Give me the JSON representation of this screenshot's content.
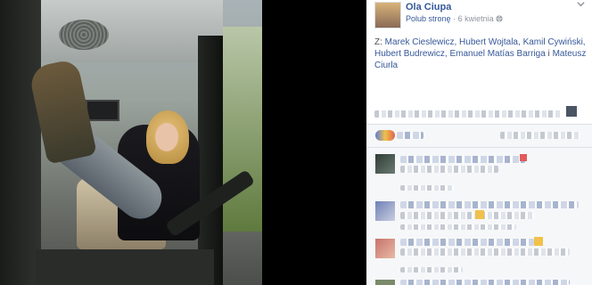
{
  "post": {
    "author": "Ola Ciupa",
    "like_page": "Polub stronę",
    "separator": "·",
    "date": "6 kwietnia",
    "privacy_icon": "globe-icon",
    "menu_icon": "chevron-down-icon"
  },
  "tags": {
    "label": "Z:",
    "people": [
      "Marek Cieslewicz,",
      "Hubert Wojtala,",
      "Kamil Cywiński,",
      "Hubert Budrewicz,",
      "Emanuel Matías Barriga",
      "i",
      "Mateusz Ciurla"
    ]
  },
  "colors": {
    "link": "#365899",
    "meta": "#90949c",
    "panel_bg": "#ffffff",
    "comment_bg": "#f6f7f9"
  }
}
